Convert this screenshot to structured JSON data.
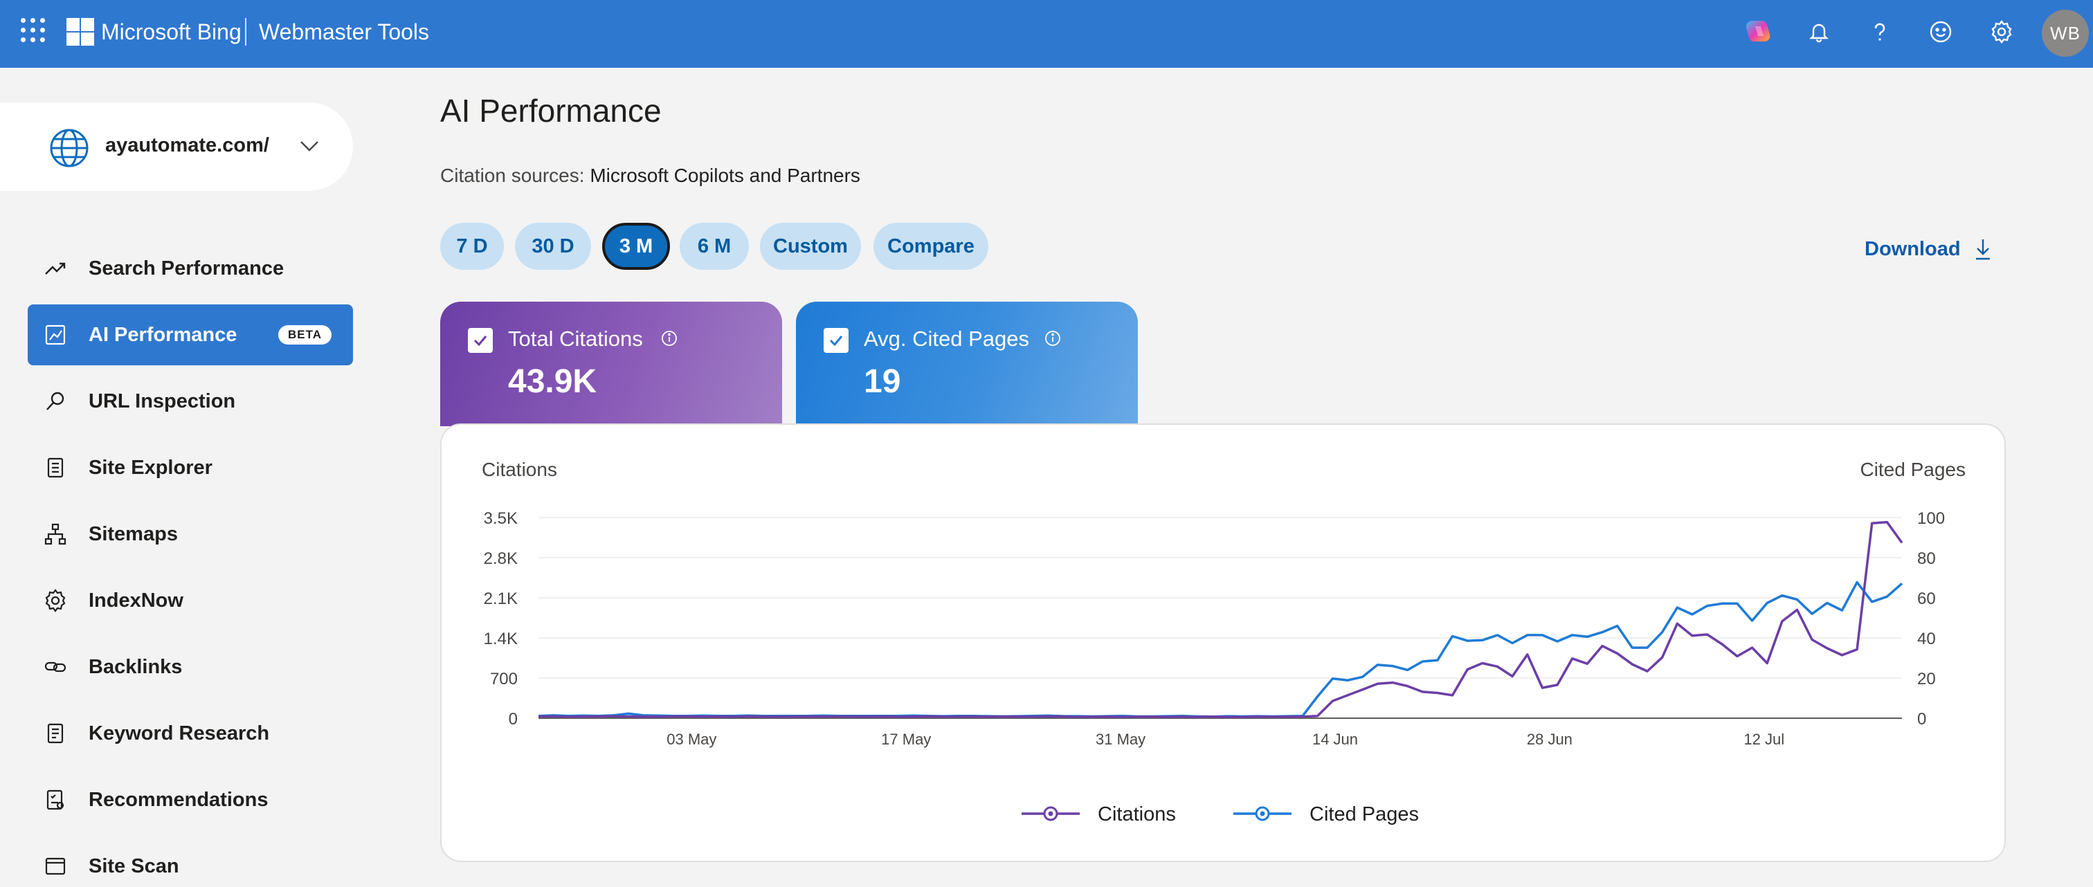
{
  "header": {
    "brand": "Microsoft Bing",
    "product": "Webmaster Tools",
    "icons": [
      "apps-waffle-icon",
      "copilot-icon",
      "bell-icon",
      "help-icon",
      "feedback-smiley-icon",
      "gear-icon"
    ],
    "avatar_initials": "WB",
    "bar_color": "#2f78d0"
  },
  "sidebar": {
    "site": "ayautomate.com/",
    "items": [
      {
        "label": "Search Performance",
        "icon": "trend-up-icon"
      },
      {
        "label": "AI Performance",
        "icon": "ai-chart-icon",
        "badge": "BETA",
        "active": true
      },
      {
        "label": "URL Inspection",
        "icon": "magnifier-icon"
      },
      {
        "label": "Site Explorer",
        "icon": "document-list-icon"
      },
      {
        "label": "Sitemaps",
        "icon": "sitemap-tree-icon"
      },
      {
        "label": "IndexNow",
        "icon": "gear-outline-icon"
      },
      {
        "label": "Backlinks",
        "icon": "link-icon"
      },
      {
        "label": "Keyword Research",
        "icon": "notes-icon"
      },
      {
        "label": "Recommendations",
        "icon": "checklist-icon"
      },
      {
        "label": "Site Scan",
        "icon": "scan-icon"
      }
    ]
  },
  "main": {
    "title": "AI Performance",
    "citation_label": "Citation sources:",
    "citation_value": "Microsoft Copilots and Partners",
    "ranges": [
      "7 D",
      "30 D",
      "3 M",
      "6 M",
      "Custom",
      "Compare"
    ],
    "active_range": "3 M",
    "download_label": "Download",
    "cards": [
      {
        "label": "Total Citations",
        "value": "43.9K",
        "checked": true
      },
      {
        "label": "Avg. Cited Pages",
        "value": "19",
        "checked": true
      }
    ]
  },
  "chart_data": {
    "type": "line",
    "ylabel_left": "Citations",
    "ylabel_right": "Cited Pages",
    "left_ticks": [
      "3.5K",
      "2.8K",
      "2.1K",
      "1.4K",
      "700",
      "0"
    ],
    "right_ticks": [
      "100",
      "80",
      "60",
      "40",
      "20",
      "0"
    ],
    "x_ticks": [
      "03 May",
      "17 May",
      "31 May",
      "14 Jun",
      "28 Jun",
      "12 Jul"
    ],
    "left_range": [
      0,
      3500
    ],
    "right_range": [
      0,
      100
    ],
    "x_range_days": 89,
    "x_tick_days": [
      10,
      24,
      38,
      52,
      66,
      80
    ],
    "grid": true,
    "legend_position": "bottom-center",
    "series": [
      {
        "name": "Citations",
        "axis": "left",
        "color": "#6b3fa6",
        "values": [
          30,
          30,
          25,
          28,
          30,
          32,
          30,
          25,
          28,
          30,
          30,
          28,
          30,
          25,
          30,
          28,
          25,
          25,
          30,
          28,
          30,
          28,
          25,
          30,
          25,
          28,
          30,
          28,
          25,
          28,
          25,
          30,
          28,
          25,
          30,
          30,
          20,
          25,
          28,
          20,
          25,
          28,
          22,
          25,
          20,
          28,
          20,
          22,
          25,
          25,
          25,
          25,
          40,
          300,
          400,
          500,
          600,
          620,
          560,
          460,
          440,
          400,
          850,
          960,
          900,
          730,
          1110,
          530,
          580,
          1040,
          950,
          1260,
          1130,
          940,
          820,
          1060,
          1650,
          1440,
          1460,
          1290,
          1080,
          1230,
          960,
          1690,
          1890,
          1370,
          1220,
          1100,
          1200,
          3400,
          3420,
          3060
        ]
      },
      {
        "name": "Cited Pages",
        "axis": "left",
        "color": "#1f7bd6",
        "values": [
          40,
          50,
          40,
          45,
          40,
          50,
          80,
          50,
          45,
          40,
          40,
          45,
          40,
          40,
          45,
          40,
          40,
          40,
          40,
          45,
          40,
          40,
          40,
          40,
          40,
          45,
          40,
          35,
          40,
          40,
          35,
          30,
          35,
          40,
          45,
          35,
          35,
          30,
          35,
          40,
          30,
          30,
          35,
          40,
          30,
          25,
          35,
          30,
          35,
          30,
          35,
          40,
          380,
          690,
          660,
          720,
          930,
          910,
          840,
          990,
          1010,
          1430,
          1350,
          1360,
          1450,
          1310,
          1450,
          1450,
          1340,
          1450,
          1420,
          1500,
          1610,
          1230,
          1230,
          1500,
          1930,
          1810,
          1960,
          2000,
          2000,
          1700,
          2010,
          2140,
          2070,
          1820,
          2010,
          1880,
          2370,
          2030,
          2120,
          2350
        ]
      }
    ]
  }
}
